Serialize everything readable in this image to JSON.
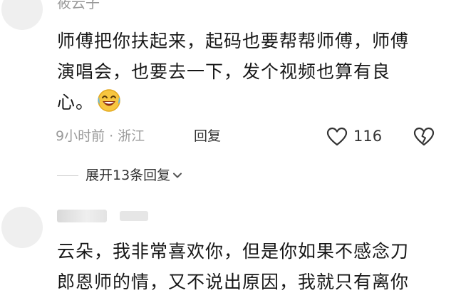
{
  "comments": [
    {
      "username": "筱云子",
      "lines": [
        "师傅把你扶起来，起码也要帮帮师傅，师傅",
        "演唱会，也要去一下，发个视频也算有良",
        "心。"
      ],
      "emoji": "laughing-crying-emoji",
      "time_ago": "9小时前",
      "location": "浙江",
      "reply_label": "回复",
      "like_count": "116",
      "expand_label": "展开13条回复"
    },
    {
      "lines": [
        "云朵，我非常喜欢你，但是你如果不感念刀",
        "郎恩师的情，又不说出原因，我就只有离你"
      ]
    }
  ],
  "icons": {
    "like": "heart-icon",
    "dislike": "broken-heart-icon",
    "expand": "chevron-down-icon"
  },
  "colors": {
    "text": "#171717",
    "meta": "#9b9b9b",
    "avatar": "#efefef"
  }
}
